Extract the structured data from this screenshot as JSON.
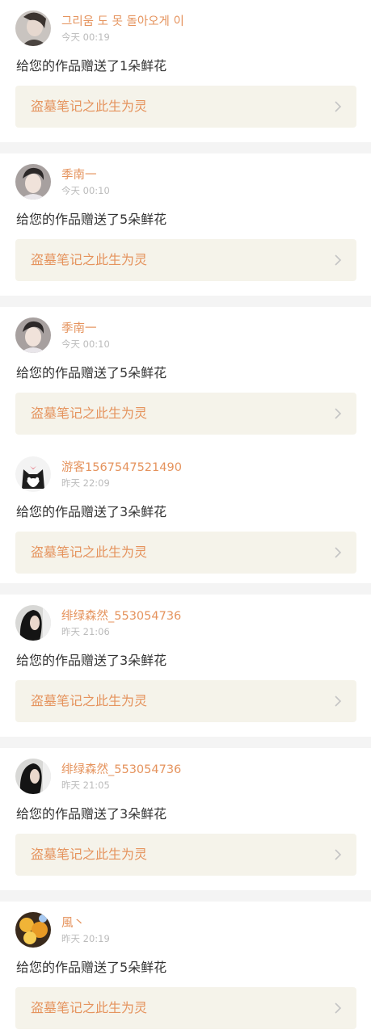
{
  "feed": [
    {
      "username": "그리움 도 못 돌아오게 이",
      "time": "今天 00:19",
      "message": "给您的作品赠送了1朵鲜花",
      "work_title": "盗墓笔记之此生为灵",
      "avatar": "avatar-portrait-dark"
    },
    {
      "username": "季南一",
      "time": "今天 00:10",
      "message": "给您的作品赠送了5朵鲜花",
      "work_title": "盗墓笔记之此生为灵",
      "avatar": "avatar-portrait-boy"
    },
    {
      "username": "季南一",
      "time": "今天 00:10",
      "message": "给您的作品赠送了5朵鲜花",
      "work_title": "盗墓笔记之此生为灵",
      "avatar": "avatar-portrait-boy"
    },
    {
      "username": "游客1567547521490",
      "time": "昨天 22:09",
      "message": "给您的作品赠送了3朵鲜花",
      "work_title": "盗墓笔记之此生为灵",
      "avatar": "avatar-cat"
    },
    {
      "username": "绯绿森然_553054736",
      "time": "昨天 21:06",
      "message": "给您的作品赠送了3朵鲜花",
      "work_title": "盗墓笔记之此生为灵",
      "avatar": "avatar-dark-hair"
    },
    {
      "username": "绯绿森然_553054736",
      "time": "昨天 21:05",
      "message": "给您的作品赠送了3朵鲜花",
      "work_title": "盗墓笔记之此生为灵",
      "avatar": "avatar-dark-hair"
    },
    {
      "username": "風丶",
      "time": "昨天 20:19",
      "message": "给您的作品赠送了5朵鲜花",
      "work_title": "盗墓笔记之此生为灵",
      "avatar": "avatar-golden"
    }
  ],
  "colors": {
    "accent": "#e5935d",
    "card_link_bg": "#f5f3ea",
    "page_bg": "#f4f4f4",
    "message_text": "#333333",
    "time_text": "#bbbbbb"
  }
}
